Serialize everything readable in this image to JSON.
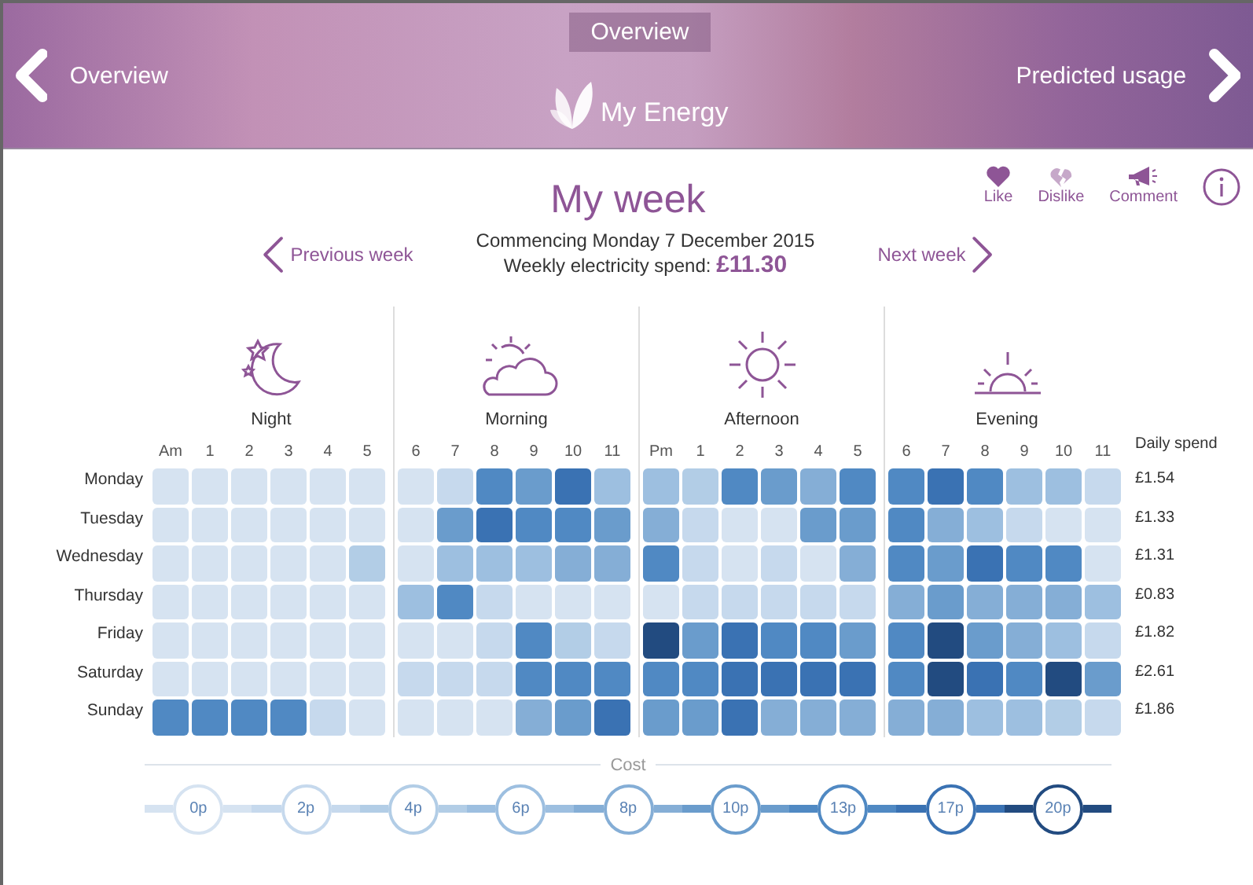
{
  "header": {
    "tab": "Overview",
    "back": "Overview",
    "forward": "Predicted usage",
    "app_name": "My Energy"
  },
  "title": "My week",
  "reactions": [
    {
      "kind": "like",
      "label": "Like"
    },
    {
      "kind": "dislike",
      "label": "Dislike"
    },
    {
      "kind": "comment",
      "label": "Comment"
    }
  ],
  "nav": {
    "previous": "Previous week",
    "next": "Next week",
    "commencing": "Commencing Monday 7 December 2015",
    "spend_label": "Weekly electricity spend:",
    "spend": "£11.30"
  },
  "periods": [
    {
      "kind": "night",
      "name": "Night",
      "hours": [
        "Am",
        "1",
        "2",
        "3",
        "4",
        "5"
      ]
    },
    {
      "kind": "morning",
      "name": "Morning",
      "hours": [
        "6",
        "7",
        "8",
        "9",
        "10",
        "11"
      ]
    },
    {
      "kind": "afternoon",
      "name": "Afternoon",
      "hours": [
        "Pm",
        "1",
        "2",
        "3",
        "4",
        "5"
      ]
    },
    {
      "kind": "evening",
      "name": "Evening",
      "hours": [
        "6",
        "7",
        "8",
        "9",
        "10",
        "11"
      ]
    }
  ],
  "spend_heading": "Daily spend",
  "days": [
    {
      "name": "Monday",
      "spend": "£1.54",
      "cells": [
        {
          "color": "#d6e3f1"
        },
        {
          "color": "#d6e3f1"
        },
        {
          "color": "#d6e3f1"
        },
        {
          "color": "#d6e3f1"
        },
        {
          "color": "#d6e3f1"
        },
        {
          "color": "#d6e3f1"
        },
        {
          "color": "#d6e3f1"
        },
        {
          "color": "#c6d9ed"
        },
        {
          "color": "#5089c3"
        },
        {
          "color": "#6a9ccc"
        },
        {
          "color": "#3a72b3"
        },
        {
          "color": "#9dbfe0"
        },
        {
          "color": "#9dbfe0"
        },
        {
          "color": "#b2cde6"
        },
        {
          "color": "#5089c3"
        },
        {
          "color": "#6a9ccc"
        },
        {
          "color": "#85aed6"
        },
        {
          "color": "#5089c3"
        },
        {
          "color": "#5089c3"
        },
        {
          "color": "#3a72b3"
        },
        {
          "color": "#5089c3"
        },
        {
          "color": "#9dbfe0"
        },
        {
          "color": "#9dbfe0"
        },
        {
          "color": "#c6d9ed"
        }
      ]
    },
    {
      "name": "Tuesday",
      "spend": "£1.33",
      "cells": [
        {
          "color": "#d6e3f1"
        },
        {
          "color": "#d6e3f1"
        },
        {
          "color": "#d6e3f1"
        },
        {
          "color": "#d6e3f1"
        },
        {
          "color": "#d6e3f1"
        },
        {
          "color": "#d6e3f1"
        },
        {
          "color": "#d6e3f1"
        },
        {
          "color": "#6a9ccc"
        },
        {
          "color": "#3a72b3"
        },
        {
          "color": "#5089c3"
        },
        {
          "color": "#5089c3"
        },
        {
          "color": "#6a9ccc"
        },
        {
          "color": "#85aed6"
        },
        {
          "color": "#c6d9ed"
        },
        {
          "color": "#d6e3f1"
        },
        {
          "color": "#d6e3f1"
        },
        {
          "color": "#6a9ccc"
        },
        {
          "color": "#6a9ccc"
        },
        {
          "color": "#5089c3"
        },
        {
          "color": "#85aed6"
        },
        {
          "color": "#9dbfe0"
        },
        {
          "color": "#c6d9ed"
        },
        {
          "color": "#d6e3f1"
        },
        {
          "color": "#d6e3f1"
        }
      ]
    },
    {
      "name": "Wednesday",
      "spend": "£1.31",
      "cells": [
        {
          "color": "#d6e3f1"
        },
        {
          "color": "#d6e3f1"
        },
        {
          "color": "#d6e3f1"
        },
        {
          "color": "#d6e3f1"
        },
        {
          "color": "#d6e3f1"
        },
        {
          "color": "#b2cde6"
        },
        {
          "color": "#d6e3f1"
        },
        {
          "color": "#9dbfe0"
        },
        {
          "color": "#9dbfe0"
        },
        {
          "color": "#9dbfe0"
        },
        {
          "color": "#85aed6"
        },
        {
          "color": "#85aed6"
        },
        {
          "color": "#5089c3"
        },
        {
          "color": "#c6d9ed"
        },
        {
          "color": "#d6e3f1"
        },
        {
          "color": "#c6d9ed"
        },
        {
          "color": "#d6e3f1"
        },
        {
          "color": "#85aed6"
        },
        {
          "color": "#5089c3"
        },
        {
          "color": "#6a9ccc"
        },
        {
          "color": "#3a72b3"
        },
        {
          "color": "#5089c3"
        },
        {
          "color": "#5089c3"
        },
        {
          "color": "#d6e3f1"
        }
      ]
    },
    {
      "name": "Thursday",
      "spend": "£0.83",
      "cells": [
        {
          "color": "#d6e3f1"
        },
        {
          "color": "#d6e3f1"
        },
        {
          "color": "#d6e3f1"
        },
        {
          "color": "#d6e3f1"
        },
        {
          "color": "#d6e3f1"
        },
        {
          "color": "#d6e3f1"
        },
        {
          "color": "#9dbfe0"
        },
        {
          "color": "#5089c3"
        },
        {
          "color": "#c6d9ed"
        },
        {
          "color": "#d6e3f1"
        },
        {
          "color": "#d6e3f1"
        },
        {
          "color": "#d6e3f1"
        },
        {
          "color": "#d6e3f1"
        },
        {
          "color": "#c6d9ed"
        },
        {
          "color": "#c6d9ed"
        },
        {
          "color": "#c6d9ed"
        },
        {
          "color": "#c6d9ed"
        },
        {
          "color": "#c6d9ed"
        },
        {
          "color": "#85aed6"
        },
        {
          "color": "#6a9ccc"
        },
        {
          "color": "#85aed6"
        },
        {
          "color": "#85aed6"
        },
        {
          "color": "#85aed6"
        },
        {
          "color": "#9dbfe0"
        }
      ]
    },
    {
      "name": "Friday",
      "spend": "£1.82",
      "cells": [
        {
          "color": "#d6e3f1"
        },
        {
          "color": "#d6e3f1"
        },
        {
          "color": "#d6e3f1"
        },
        {
          "color": "#d6e3f1"
        },
        {
          "color": "#d6e3f1"
        },
        {
          "color": "#d6e3f1"
        },
        {
          "color": "#d6e3f1"
        },
        {
          "color": "#d6e3f1"
        },
        {
          "color": "#c6d9ed"
        },
        {
          "color": "#5089c3"
        },
        {
          "color": "#b2cde6"
        },
        {
          "color": "#c6d9ed"
        },
        {
          "color": "#224b80"
        },
        {
          "color": "#6a9ccc"
        },
        {
          "color": "#3a72b3"
        },
        {
          "color": "#5089c3"
        },
        {
          "color": "#5089c3"
        },
        {
          "color": "#6a9ccc"
        },
        {
          "color": "#5089c3"
        },
        {
          "color": "#224b80"
        },
        {
          "color": "#6a9ccc"
        },
        {
          "color": "#85aed6"
        },
        {
          "color": "#9dbfe0"
        },
        {
          "color": "#c6d9ed"
        }
      ]
    },
    {
      "name": "Saturday",
      "spend": "£2.61",
      "cells": [
        {
          "color": "#d6e3f1"
        },
        {
          "color": "#d6e3f1"
        },
        {
          "color": "#d6e3f1"
        },
        {
          "color": "#d6e3f1"
        },
        {
          "color": "#d6e3f1"
        },
        {
          "color": "#d6e3f1"
        },
        {
          "color": "#c6d9ed"
        },
        {
          "color": "#c6d9ed"
        },
        {
          "color": "#c6d9ed"
        },
        {
          "color": "#5089c3"
        },
        {
          "color": "#5089c3"
        },
        {
          "color": "#5089c3"
        },
        {
          "color": "#5089c3"
        },
        {
          "color": "#5089c3"
        },
        {
          "color": "#3a72b3"
        },
        {
          "color": "#3a72b3"
        },
        {
          "color": "#3a72b3"
        },
        {
          "color": "#3a72b3"
        },
        {
          "color": "#5089c3"
        },
        {
          "color": "#224b80"
        },
        {
          "color": "#3a72b3"
        },
        {
          "color": "#5089c3"
        },
        {
          "color": "#224b80"
        },
        {
          "color": "#6a9ccc"
        }
      ]
    },
    {
      "name": "Sunday",
      "spend": "£1.86",
      "cells": [
        {
          "color": "#5089c3"
        },
        {
          "color": "#5089c3"
        },
        {
          "color": "#5089c3"
        },
        {
          "color": "#5089c3"
        },
        {
          "color": "#c6d9ed"
        },
        {
          "color": "#d6e3f1"
        },
        {
          "color": "#d6e3f1"
        },
        {
          "color": "#d6e3f1"
        },
        {
          "color": "#d6e3f1"
        },
        {
          "color": "#85aed6"
        },
        {
          "color": "#6a9ccc"
        },
        {
          "color": "#3a72b3"
        },
        {
          "color": "#6a9ccc"
        },
        {
          "color": "#6a9ccc"
        },
        {
          "color": "#3a72b3"
        },
        {
          "color": "#85aed6"
        },
        {
          "color": "#85aed6"
        },
        {
          "color": "#85aed6"
        },
        {
          "color": "#85aed6"
        },
        {
          "color": "#85aed6"
        },
        {
          "color": "#9dbfe0"
        },
        {
          "color": "#9dbfe0"
        },
        {
          "color": "#b2cde6"
        },
        {
          "color": "#c6d9ed"
        }
      ]
    }
  ],
  "cost": {
    "title": "Cost",
    "steps": [
      {
        "label": "0p",
        "color": "#d6e3f1"
      },
      {
        "label": "2p",
        "color": "#c6d9ed"
      },
      {
        "label": "4p",
        "color": "#b2cde6"
      },
      {
        "label": "6p",
        "color": "#9dbfe0"
      },
      {
        "label": "8p",
        "color": "#85aed6"
      },
      {
        "label": "10p",
        "color": "#6a9ccc"
      },
      {
        "label": "13p",
        "color": "#5089c3"
      },
      {
        "label": "17p",
        "color": "#3a72b3"
      },
      {
        "label": "20p",
        "color": "#224b80"
      }
    ]
  }
}
